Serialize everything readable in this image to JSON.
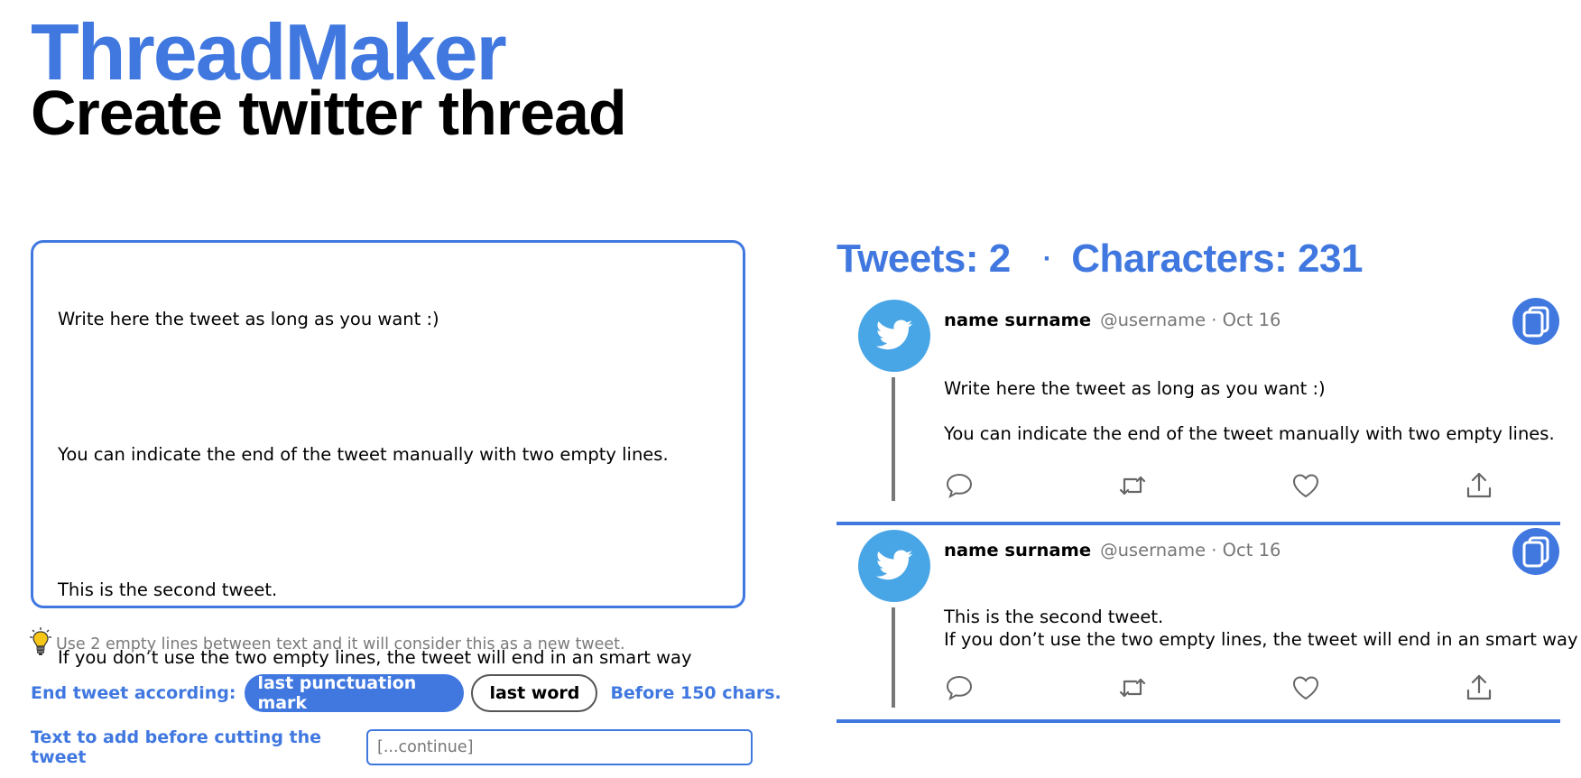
{
  "header": {
    "title": "ThreadMaker",
    "subtitle": "Create twitter thread"
  },
  "editor": {
    "lines": [
      "Write here the tweet as long as you want :)",
      "",
      "You can indicate the end of the tweet manually with two empty lines.",
      "",
      "This is the second tweet.",
      "If you don’t use the two empty lines, the tweet will end in an smart way"
    ]
  },
  "hint": {
    "text": "Use 2 empty lines between text and it will consider this as a new tweet.",
    "icon": "lightbulb-icon"
  },
  "end_options": {
    "label": "End tweet according:",
    "options": [
      {
        "label": "last punctuation mark",
        "selected": true
      },
      {
        "label": "last word",
        "selected": false
      }
    ],
    "limit_label": "Before 150 chars."
  },
  "continue": {
    "label": "Text to add before cutting the tweet",
    "placeholder": "[...continue]",
    "value": ""
  },
  "stats": {
    "tweets_label": "Tweets: 2",
    "separator": "·",
    "chars_label": "Characters: 231"
  },
  "tweets": [
    {
      "name": "name surname",
      "meta": "@username · Oct 16",
      "body": [
        "Write here the tweet as long as you want :)",
        "",
        "You can indicate the end of the tweet manually with two empty lines."
      ]
    },
    {
      "name": "name surname",
      "meta": "@username · Oct 16",
      "body": [
        "This is the second tweet.",
        "If you don’t use the two empty lines, the tweet will end in an smart way"
      ]
    }
  ],
  "colors": {
    "accent": "#4078e0",
    "avatar": "#49a6e6",
    "muted": "#777777"
  },
  "icons": {
    "avatar": "twitter-bird-icon",
    "copy": "copy-icon",
    "actions": [
      "reply-icon",
      "retweet-icon",
      "like-icon",
      "share-icon"
    ]
  }
}
